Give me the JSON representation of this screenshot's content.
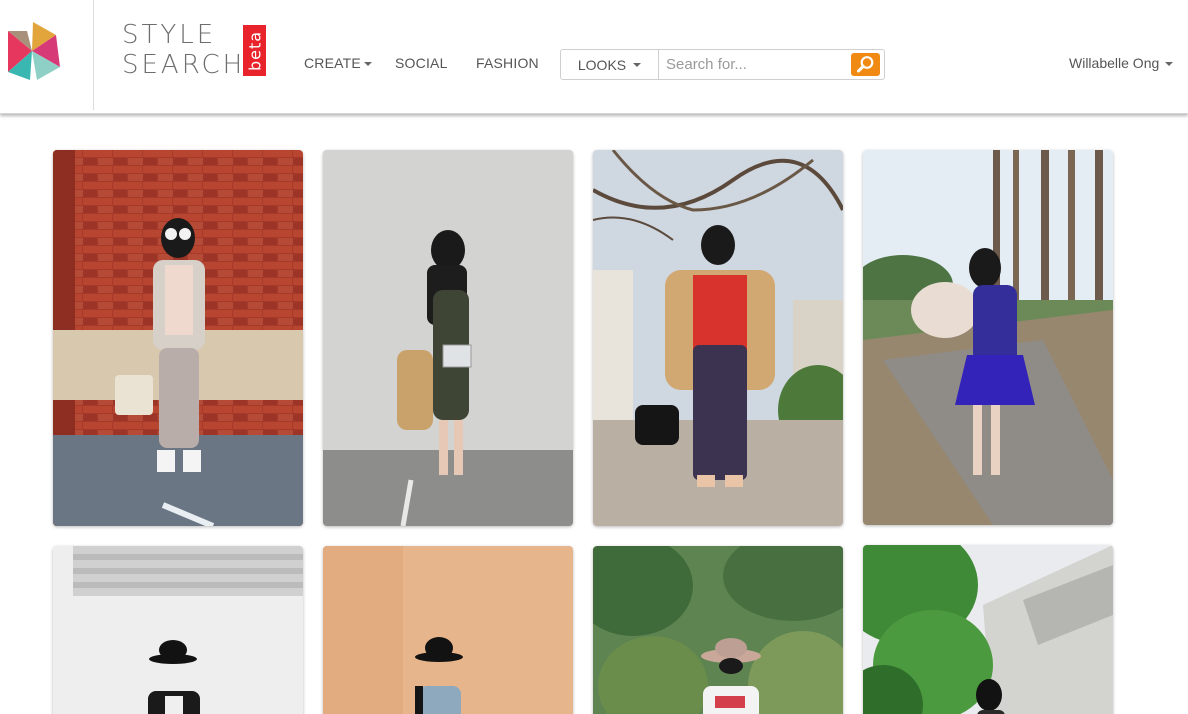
{
  "brand": {
    "line1": "STYLE",
    "line2": "SEARCH",
    "badge": "beta",
    "badge_color": "#e8232b"
  },
  "nav": {
    "create_label": "CREATE",
    "social_label": "SOCIAL",
    "fashion_label": "FASHION"
  },
  "search": {
    "category_label": "LOOKS",
    "placeholder": "Search for...",
    "value": "",
    "button_color": "#f08a13",
    "button_icon": "magnifier-icon"
  },
  "user": {
    "name": "Willabelle Ong"
  },
  "colors": {
    "accent": "#f08a13",
    "text": "#555555"
  },
  "looks": [
    {
      "row": 1,
      "col": 1,
      "scene": "red brick wall, white sunglasses, light jacket, pink top, grey trousers, white platform shoes"
    },
    {
      "row": 1,
      "col": 2,
      "scene": "grey wall, green lace dress, camel coat, clear bag"
    },
    {
      "row": 1,
      "col": 3,
      "scene": "tree branches, red blouse, plaid trousers, camel coat, black handbag"
    },
    {
      "row": 1,
      "col": 4,
      "scene": "tall pine trees, blue dress, fur jacket, white heels"
    },
    {
      "row": 2,
      "col": 1,
      "scene": "white wall, black hat, black and white outfit"
    },
    {
      "row": 2,
      "col": 2,
      "scene": "peach wall, black hat, denim shirt"
    },
    {
      "row": 2,
      "col": 3,
      "scene": "green bushes, beige floppy hat, sunglasses, white top"
    },
    {
      "row": 2,
      "col": 4,
      "scene": "green tree, white building, sunglasses"
    }
  ]
}
